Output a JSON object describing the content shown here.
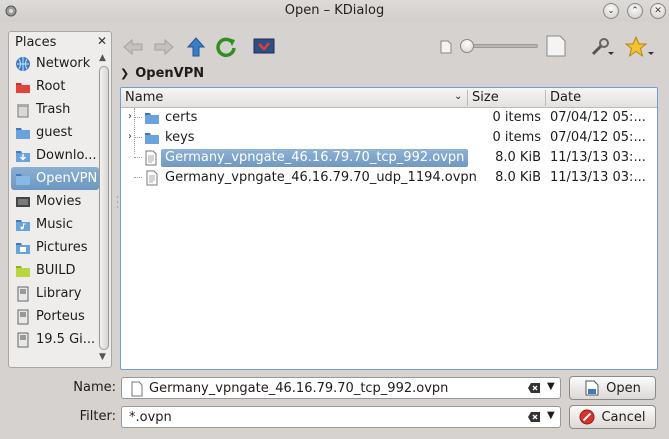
{
  "window": {
    "title": "Open – KDialog"
  },
  "places": {
    "header": "Places",
    "items": [
      {
        "label": "Network",
        "icon": "network-icon"
      },
      {
        "label": "Root",
        "icon": "root-folder-icon"
      },
      {
        "label": "Trash",
        "icon": "trash-icon"
      },
      {
        "label": "guest",
        "icon": "home-folder-icon"
      },
      {
        "label": "Downlo...",
        "icon": "downloads-folder-icon"
      },
      {
        "label": "OpenVPN",
        "icon": "openvpn-folder-icon"
      },
      {
        "label": "Movies",
        "icon": "movies-icon"
      },
      {
        "label": "Music",
        "icon": "music-folder-icon"
      },
      {
        "label": "Pictures",
        "icon": "pictures-folder-icon"
      },
      {
        "label": "BUILD",
        "icon": "build-folder-icon"
      },
      {
        "label": "Library",
        "icon": "drive-icon"
      },
      {
        "label": "Porteus",
        "icon": "drive-icon"
      },
      {
        "label": "19.5 Gi...",
        "icon": "drive-icon"
      }
    ],
    "active_index": 5
  },
  "breadcrumb": {
    "current": "OpenVPN"
  },
  "file_view": {
    "columns": [
      "Name",
      "Size",
      "Date"
    ],
    "rows": [
      {
        "name": "certs",
        "size": "0 items",
        "date": "07/04/12 05:...",
        "type": "folder"
      },
      {
        "name": "keys",
        "size": "0 items",
        "date": "07/04/12 05:...",
        "type": "folder"
      },
      {
        "name": "Germany_vpngate_46.16.79.70_tcp_992.ovpn",
        "size": "8.0 KiB",
        "date": "11/13/13 03:...",
        "type": "file",
        "selected": true
      },
      {
        "name": "Germany_vpngate_46.16.79.70_udp_1194.ovpn",
        "size": "8.0 KiB",
        "date": "11/13/13 03:...",
        "type": "file"
      }
    ]
  },
  "form": {
    "name_label": "Name:",
    "name_value": "Germany_vpngate_46.16.79.70_tcp_992.ovpn",
    "filter_label": "Filter:",
    "filter_value": "*.ovpn"
  },
  "buttons": {
    "open": "Open",
    "cancel": "Cancel"
  },
  "colors": {
    "selection": "#7aa3cb",
    "accent_blue": "#3e7ac1"
  }
}
